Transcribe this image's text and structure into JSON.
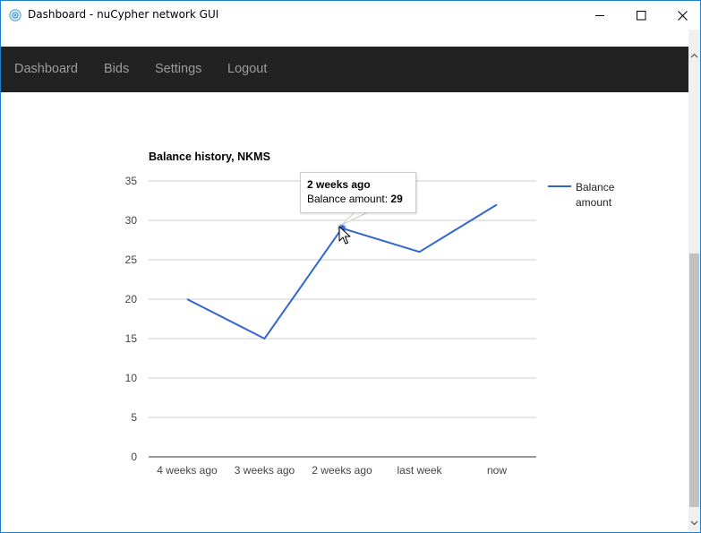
{
  "window": {
    "title": "Dashboard - nuCypher network GUI",
    "minimize": "minimize",
    "maximize": "maximize",
    "close": "close"
  },
  "nav": {
    "items": [
      {
        "label": "Dashboard"
      },
      {
        "label": "Bids"
      },
      {
        "label": "Settings"
      },
      {
        "label": "Logout"
      }
    ]
  },
  "tooltip": {
    "title": "2 weeks ago",
    "label": "Balance amount:",
    "value": "29"
  },
  "chart_data": {
    "type": "line",
    "title": "Balance history, NKMS",
    "categories": [
      "4 weeks ago",
      "3 weeks ago",
      "2 weeks ago",
      "last week",
      "now"
    ],
    "series": [
      {
        "name": "Balance amount",
        "values": [
          20,
          15,
          29,
          26,
          32
        ],
        "color": "#3366cc"
      }
    ],
    "ylim": [
      0,
      35
    ],
    "yticks": [
      "0",
      "5",
      "10",
      "15",
      "20",
      "25",
      "30",
      "35"
    ],
    "grid": true,
    "legend": "right",
    "legend_lines": [
      "Balance",
      "amount"
    ],
    "highlighted_index": 2
  },
  "colors": {
    "navbar": "#222222",
    "nav_text": "#9d9d9d",
    "line": "#3366cc",
    "window_border": "#1d7fd1"
  }
}
